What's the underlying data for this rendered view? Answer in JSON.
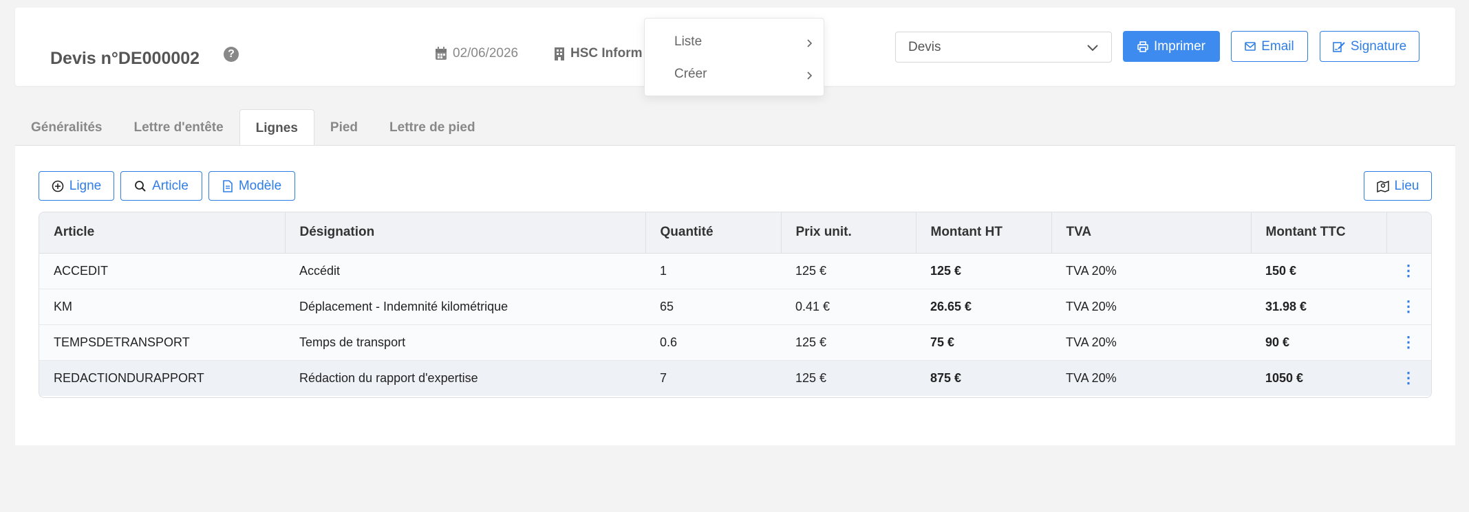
{
  "header": {
    "title": "Devis n°DE000002",
    "help_icon": "question-circle-icon",
    "date": "02/06/2026",
    "company": "HSC Inform",
    "type_select": {
      "value": "Devis"
    },
    "buttons": {
      "print": "Imprimer",
      "email": "Email",
      "signature": "Signature"
    }
  },
  "dropdown": {
    "items": [
      {
        "label": "Liste"
      },
      {
        "label": "Créer"
      }
    ]
  },
  "tabs": [
    {
      "label": "Généralités"
    },
    {
      "label": "Lettre d'entête"
    },
    {
      "label": "Lignes"
    },
    {
      "label": "Pied"
    },
    {
      "label": "Lettre de pied"
    }
  ],
  "active_tab": "Lignes",
  "toolbar": {
    "ligne": "Ligne",
    "article": "Article",
    "modele": "Modèle",
    "lieu": "Lieu"
  },
  "table": {
    "columns": [
      "Article",
      "Désignation",
      "Quantité",
      "Prix unit.",
      "Montant HT",
      "TVA",
      "Montant TTC"
    ],
    "rows": [
      {
        "article": "ACCEDIT",
        "designation": "Accédit",
        "quantite": "1",
        "prix": "125 €",
        "ht": "125 €",
        "tva": "TVA 20%",
        "ttc": "150 €"
      },
      {
        "article": "KM",
        "designation": "Déplacement - Indemnité kilométrique",
        "quantite": "65",
        "prix": "0.41 €",
        "ht": "26.65 €",
        "tva": "TVA 20%",
        "ttc": "31.98 €"
      },
      {
        "article": "TEMPSDETRANSPORT",
        "designation": "Temps de transport",
        "quantite": "0.6",
        "prix": "125 €",
        "ht": "75 €",
        "tva": "TVA 20%",
        "ttc": "90 €"
      },
      {
        "article": "REDACTIONDURAPPORT",
        "designation": "Rédaction du rapport d'expertise",
        "quantite": "7",
        "prix": "125 €",
        "ht": "875 €",
        "tva": "TVA 20%",
        "ttc": "1050 €"
      }
    ]
  },
  "colors": {
    "primary": "#3d8bef",
    "outline": "#2f7ee6"
  }
}
